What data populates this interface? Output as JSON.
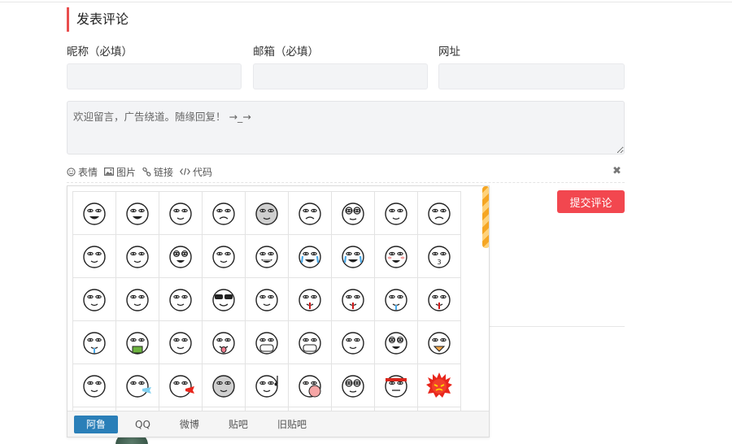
{
  "form": {
    "title": "发表评论",
    "fields": [
      {
        "label": "昵称（必填）",
        "value": "",
        "placeholder": ""
      },
      {
        "label": "邮箱（必填）",
        "value": "",
        "placeholder": ""
      },
      {
        "label": "网址",
        "value": "",
        "placeholder": ""
      }
    ],
    "comment_placeholder": "欢迎留言，广告绕道。随缘回复！ →_→",
    "submit_label": "提交评论"
  },
  "toolbar": {
    "items": [
      {
        "label": "表情",
        "icon": "smile-icon"
      },
      {
        "label": "图片",
        "icon": "image-icon"
      },
      {
        "label": "链接",
        "icon": "link-icon"
      },
      {
        "label": "代码",
        "icon": "code-icon"
      }
    ],
    "close_symbol": "✖"
  },
  "emoji_panel": {
    "tabs": [
      "阿鲁",
      "QQ",
      "微博",
      "贴吧",
      "旧贴吧"
    ],
    "active_tab": "阿鲁",
    "icons": [
      "grin-face-icon",
      "squint-face-icon",
      "smile-face-icon",
      "frown-face-icon",
      "gray-face-icon",
      "sad-face-icon",
      "goggle-face-icon",
      "dot-face-icon",
      "worried-face-icon",
      "flat-face-icon",
      "x-eyes-face-icon",
      "dizzy-face-icon",
      "smug-face-icon",
      "toothy-face-icon",
      "crying-face-icon",
      "laugh-cry-face-icon",
      "blush-face-icon",
      "kiss-face-icon",
      "annoyed-face-icon",
      "plain-face-icon",
      "shocked-face-icon",
      "sunglasses-face-icon",
      "hand-face-icon",
      "nosebleed-face-icon",
      "bleeding-face-icon",
      "drool-face-icon",
      "blood-face-icon",
      "tear-face-icon",
      "vomit-face-icon",
      "bandage-face-icon",
      "tongue-face-icon",
      "mask-face-icon",
      "taped-mouth-face-icon",
      "shadow-face-icon",
      "spiral-eyes-face-icon",
      "beak-face-icon",
      "smoking-face-icon",
      "spit-face-icon",
      "fire-breath-face-icon",
      "ghost-face-icon",
      "music-face-icon",
      "bubble-face-icon",
      "glasses-face-icon",
      "headband-face-icon",
      "fire-face-icon",
      "partial-face-icon",
      "partial-face-icon",
      "partial-face-icon",
      "partial-face-icon",
      "partial-face-icon",
      "partial-face-icon",
      "partial-face-icon",
      "partial-face-icon",
      "partial-face-icon"
    ],
    "colors": {
      "scrollbar": "#f5a623",
      "active_tab": "#2a7fb8"
    }
  },
  "colors": {
    "accent": "#e94e4e",
    "submit": "#f2474f",
    "input_bg": "#f3f4f6"
  }
}
